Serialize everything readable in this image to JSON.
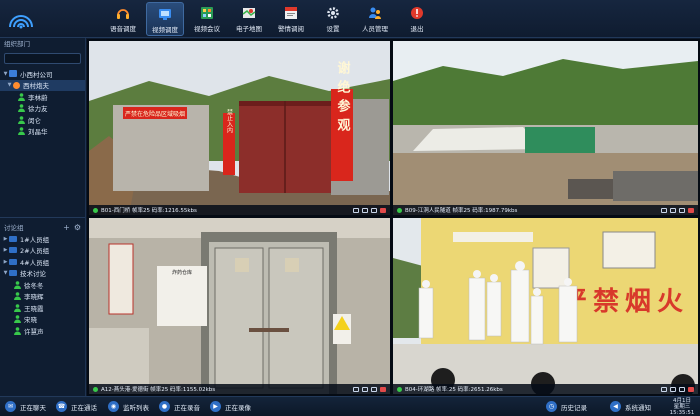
{
  "nav": [
    {
      "label": "语音调度",
      "icon": "headset-icon",
      "active": false
    },
    {
      "label": "视频调度",
      "icon": "video-dispatch-icon",
      "active": true
    },
    {
      "label": "视频会议",
      "icon": "video-conference-icon",
      "active": false
    },
    {
      "label": "电子地图",
      "icon": "map-icon",
      "active": false
    },
    {
      "label": "警情调阅",
      "icon": "alarm-icon",
      "active": false
    },
    {
      "label": "设置",
      "icon": "gear-icon",
      "active": false
    },
    {
      "label": "人员管理",
      "icon": "users-icon",
      "active": false
    },
    {
      "label": "退出",
      "icon": "power-icon",
      "active": false
    }
  ],
  "sidebar": {
    "org_title": "组织部门",
    "org_tree": [
      {
        "label": "小西村公司",
        "level": 0
      },
      {
        "label": "西村炮夫",
        "level": 1
      },
      {
        "label": "李林蔚",
        "level": 2
      },
      {
        "label": "徐力友",
        "level": 2
      },
      {
        "label": "闵仑",
        "level": 2
      },
      {
        "label": "刘晶华",
        "level": 2
      }
    ],
    "group_title": "讨论组",
    "groups": [
      {
        "label": "1#人员组"
      },
      {
        "label": "2#人员组"
      },
      {
        "label": "4#人员组"
      },
      {
        "label": "技术讨论"
      }
    ],
    "members": [
      {
        "label": "徐冬冬"
      },
      {
        "label": "李晓辉"
      },
      {
        "label": "王晓霞"
      },
      {
        "label": "宋晓"
      },
      {
        "label": "许慧声"
      }
    ]
  },
  "videos": [
    {
      "caption": "B01-西门桥 帧率25 码率:1216.55kbs"
    },
    {
      "caption": "B09-江洞人民隧道 帧率25 码率:1987.79kbs"
    },
    {
      "caption": "A12-燕头港·爱德街 帧率25 码率:1155.02kbs"
    },
    {
      "caption": "B04-环湖路 帧率:25 码率:2651.26kbs"
    }
  ],
  "scene_text": {
    "banner_left": "严禁在危险品区域吸烟",
    "banner_vertical_1": "谢绝参观",
    "banner_vertical_2": "禁止入内",
    "warehouse_sign": "炸药仓库",
    "wall_text": "严禁烟火"
  },
  "bottom": [
    {
      "label": "正在聊天",
      "icon": "chat-icon"
    },
    {
      "label": "正在通话",
      "icon": "phone-icon"
    },
    {
      "label": "监听列表",
      "icon": "monitor-icon"
    },
    {
      "label": "正在录音",
      "icon": "record-icon"
    },
    {
      "label": "正在录像",
      "icon": "camera-icon"
    },
    {
      "label": "历史记录",
      "icon": "history-icon"
    },
    {
      "label": "系统通知",
      "icon": "notice-icon"
    }
  ],
  "clock": {
    "date": "4月1日",
    "weekday": "星期三",
    "time": "15:35:51"
  }
}
